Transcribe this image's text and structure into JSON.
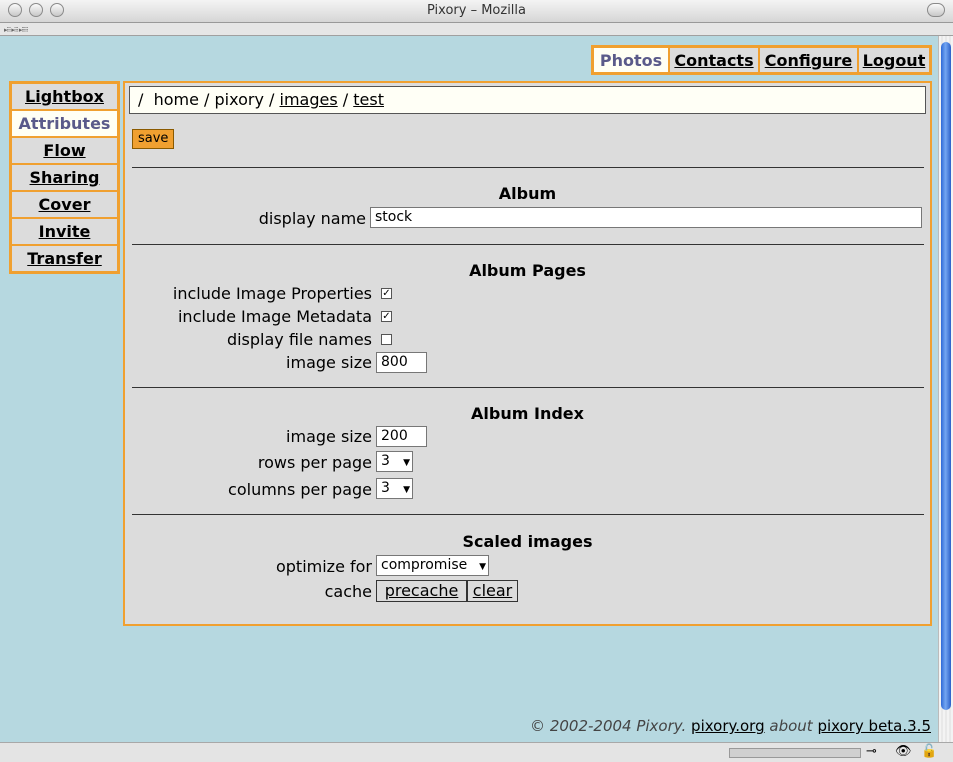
{
  "window": {
    "title": "Pixory – Mozilla"
  },
  "top_nav": [
    {
      "label": "Photos",
      "active": true
    },
    {
      "label": "Contacts",
      "active": false
    },
    {
      "label": "Configure",
      "active": false
    },
    {
      "label": "Logout",
      "active": false
    }
  ],
  "side_nav": [
    {
      "label": "Lightbox",
      "active": false
    },
    {
      "label": "Attributes",
      "active": true
    },
    {
      "label": "Flow",
      "active": false
    },
    {
      "label": "Sharing",
      "active": false
    },
    {
      "label": "Cover",
      "active": false
    },
    {
      "label": "Invite",
      "active": false
    },
    {
      "label": "Transfer",
      "active": false
    }
  ],
  "breadcrumb": {
    "root": "/",
    "home": "home",
    "sep": "/",
    "pixory": "pixory",
    "images": "images",
    "test": "test"
  },
  "save_label": "save",
  "album": {
    "title": "Album",
    "display_name_label": "display name",
    "display_name_value": "stock"
  },
  "album_pages": {
    "title": "Album Pages",
    "include_props_label": "include Image Properties",
    "include_props_checked": true,
    "include_meta_label": "include Image Metadata",
    "include_meta_checked": true,
    "display_file_names_label": "display file names",
    "display_file_names_checked": false,
    "image_size_label": "image size",
    "image_size_value": "800"
  },
  "album_index": {
    "title": "Album Index",
    "image_size_label": "image size",
    "image_size_value": "200",
    "rows_label": "rows per page",
    "rows_value": "3",
    "cols_label": "columns per page",
    "cols_value": "3"
  },
  "scaled_images": {
    "title": "Scaled images",
    "optimize_label": "optimize for",
    "optimize_value": "compromise",
    "cache_label": "cache",
    "precache_label": "precache",
    "clear_label": "clear"
  },
  "footer": {
    "copyright": "© 2002-2004 Pixory.",
    "site_link": "pixory.org",
    "about": "about",
    "version_link": "pixory beta.3.5"
  },
  "colors": {
    "accent": "#f0a030",
    "page_bg": "#b6d8e0",
    "panel_bg": "#dcdcdc"
  }
}
